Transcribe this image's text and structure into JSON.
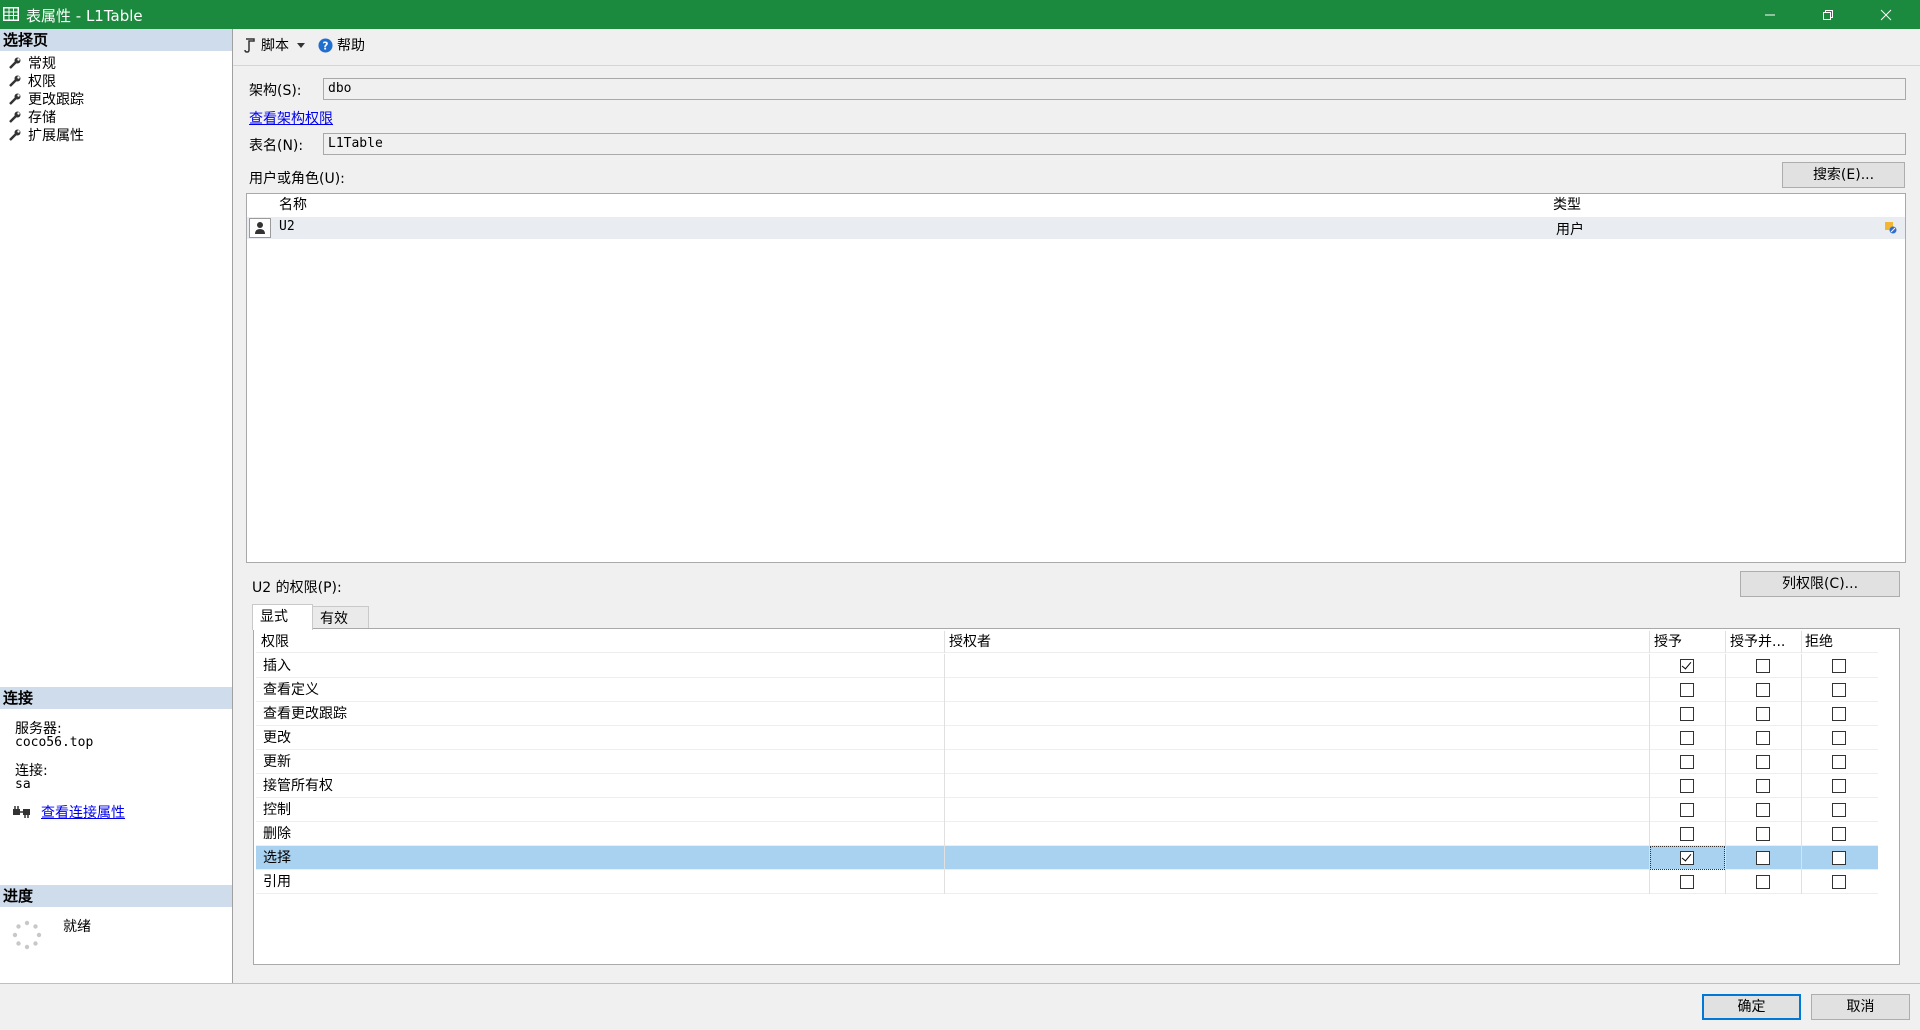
{
  "window": {
    "title": "表属性 - L1Table"
  },
  "left_panel": {
    "select_page_header": "选择页",
    "pages": [
      {
        "label": "常规"
      },
      {
        "label": "权限"
      },
      {
        "label": "更改跟踪"
      },
      {
        "label": "存储"
      },
      {
        "label": "扩展属性"
      }
    ],
    "connection_header": "连接",
    "server_label": "服务器:",
    "server_value": "coco56.top",
    "connection_label": "连接:",
    "connection_value": "sa",
    "view_connection_link": "查看连接属性",
    "progress_header": "进度",
    "progress_status": "就绪"
  },
  "toolbar": {
    "script_label": "脚本",
    "help_label": "帮助"
  },
  "form": {
    "schema_label": "架构(S):",
    "schema_value": "dbo",
    "view_schema_link": "查看架构权限",
    "table_name_label": "表名(N):",
    "table_name_value": "L1Table",
    "users_label": "用户或角色(U):",
    "search_button": "搜索(E)..."
  },
  "users_grid": {
    "columns": [
      "名称",
      "类型"
    ],
    "rows": [
      {
        "name": "U2",
        "type": "用户"
      }
    ]
  },
  "permissions": {
    "label": "U2 的权限(P):",
    "column_perm_button": "列权限(C)...",
    "tabs": [
      {
        "label": "显式",
        "active": true
      },
      {
        "label": "有效",
        "active": false
      }
    ],
    "columns": [
      "权限",
      "授权者",
      "授予",
      "授予并...",
      "拒绝"
    ],
    "rows": [
      {
        "name": "插入",
        "grantor": "",
        "grant": true,
        "with_grant": false,
        "deny": false
      },
      {
        "name": "查看定义",
        "grantor": "",
        "grant": false,
        "with_grant": false,
        "deny": false
      },
      {
        "name": "查看更改跟踪",
        "grantor": "",
        "grant": false,
        "with_grant": false,
        "deny": false
      },
      {
        "name": "更改",
        "grantor": "",
        "grant": false,
        "with_grant": false,
        "deny": false
      },
      {
        "name": "更新",
        "grantor": "",
        "grant": false,
        "with_grant": false,
        "deny": false
      },
      {
        "name": "接管所有权",
        "grantor": "",
        "grant": false,
        "with_grant": false,
        "deny": false
      },
      {
        "name": "控制",
        "grantor": "",
        "grant": false,
        "with_grant": false,
        "deny": false
      },
      {
        "name": "删除",
        "grantor": "",
        "grant": false,
        "with_grant": false,
        "deny": false
      },
      {
        "name": "选择",
        "grantor": "",
        "grant": true,
        "with_grant": false,
        "deny": false,
        "selected": true
      },
      {
        "name": "引用",
        "grantor": "",
        "grant": false,
        "with_grant": false,
        "deny": false
      }
    ]
  },
  "buttons": {
    "ok": "确定",
    "cancel": "取消"
  },
  "colors": {
    "titlebar": "#1b8a3e",
    "section_header": "#cfdcec",
    "selected_row": "#a9d1f0",
    "link": "#0000ee"
  }
}
